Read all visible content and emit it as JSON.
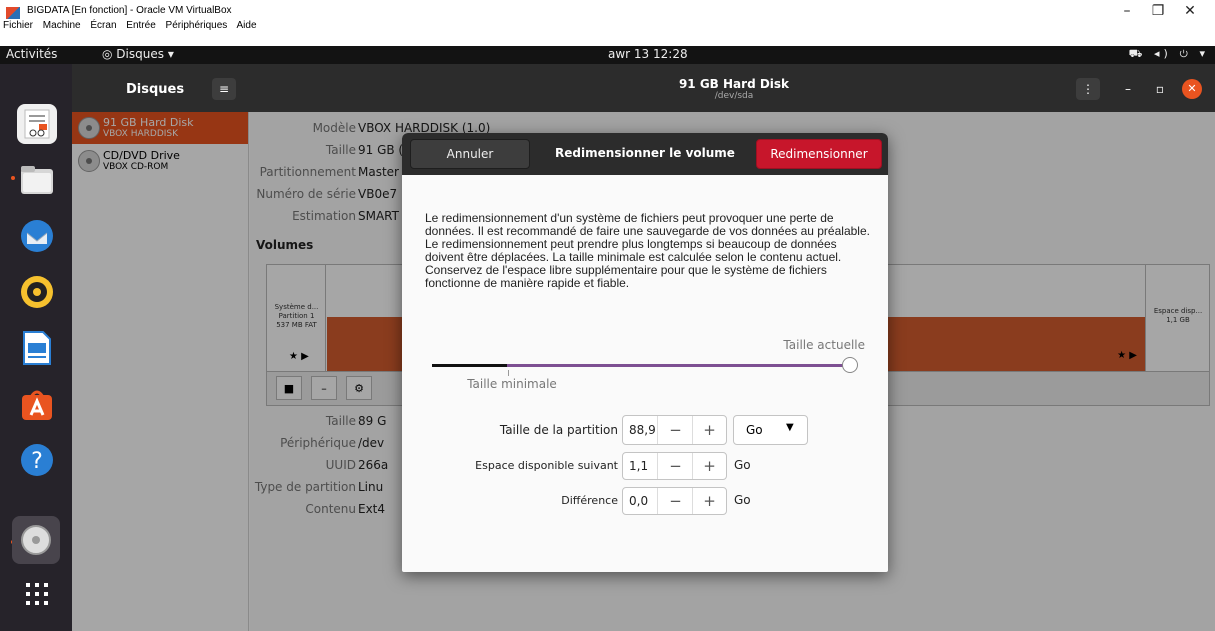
{
  "vbox": {
    "title": "BIGDATA [En fonction] - Oracle VM VirtualBox",
    "menu": [
      "Fichier",
      "Machine",
      "Écran",
      "Entrée",
      "Périphériques",
      "Aide"
    ],
    "controls": {
      "minimize": "–",
      "restore": "❐",
      "close": "✕"
    }
  },
  "topbar": {
    "activities": "Activités",
    "app": "Disques",
    "app_arrow": "▾",
    "clock": "awr 13  12:28",
    "tray": "⛟ ◂) ⏻ ▾"
  },
  "disks": {
    "header_left": "Disques",
    "hamburger": "≡",
    "title": "91 GB Hard Disk",
    "subtitle": "/dev/sda",
    "drive_menu": "⋮",
    "win_min": "–",
    "win_max": "▫",
    "win_close": "✕",
    "drives": [
      {
        "name": "91 GB Hard Disk",
        "sub": "VBOX HARDDISK"
      },
      {
        "name": "CD/DVD Drive",
        "sub": "VBOX CD-ROM"
      }
    ],
    "props": [
      {
        "k": "Modèle",
        "v": "VBOX HARDDISK (1.0)"
      },
      {
        "k": "Taille",
        "v": "91 GB ("
      },
      {
        "k": "Partitionnement",
        "v": "Master"
      },
      {
        "k": "Numéro de série",
        "v": "VB0e7"
      },
      {
        "k": "Estimation",
        "v": "SMART"
      }
    ],
    "volumes_label": "Volumes",
    "partition1": [
      "Système d...",
      "Partition 1",
      "537 MB FAT"
    ],
    "free": [
      "Espace disp...",
      "1,1 GB"
    ],
    "star": "★ ▶",
    "tools": [
      "■",
      "–",
      "⚙"
    ],
    "vol_props": [
      {
        "k": "Taille",
        "v": "89 G"
      },
      {
        "k": "Périphérique",
        "v": "/dev"
      },
      {
        "k": "UUID",
        "v": "266a"
      },
      {
        "k": "Type de partition",
        "v": "Linu"
      },
      {
        "k": "Contenu",
        "v": "Ext4"
      }
    ]
  },
  "dialog": {
    "cancel": "Annuler",
    "title": "Redimensionner le volume",
    "confirm": "Redimensionner",
    "description": "Le redimensionnement d'un système de fichiers peut provoquer une perte de données. Il est recommandé de faire une sauvegarde de vos données au préalable. Le redimensionnement peut prendre plus longtemps si beaucoup de données doivent être déplacées. La taille minimale est calculée selon le contenu actuel. Conservez de l'espace libre supplémentaire pour que le système de fichiers fonctionne de manière rapide et fiable.",
    "current_size_label": "Taille actuelle",
    "min_size_label": "Taille minimale",
    "slider_value": 1.0,
    "slider_min": 0.18,
    "fields": [
      {
        "label": "Taille de la partition",
        "value": "88,9",
        "unit": "Go"
      },
      {
        "label": "Espace disponible suivant",
        "value": "1,1",
        "unit": "Go"
      },
      {
        "label": "Différence",
        "value": "0,0",
        "unit": "Go"
      }
    ],
    "minus": "−",
    "plus": "+",
    "combo_arrow": "▼"
  }
}
